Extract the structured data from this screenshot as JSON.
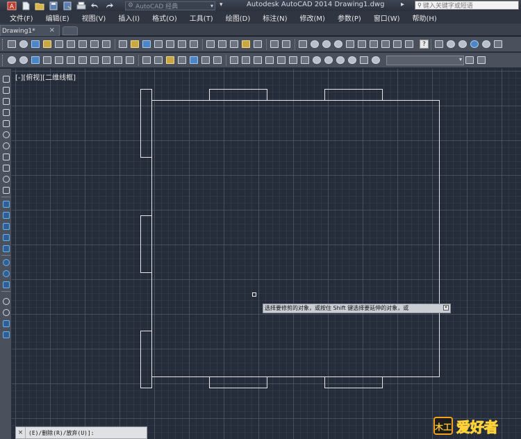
{
  "app": {
    "title": "Autodesk AutoCAD 2014    Drawing1.dwg",
    "workspace": "AutoCAD 经典",
    "help_search_placeholder": "键入关键字或短语"
  },
  "menu": [
    "文件(F)",
    "编辑(E)",
    "视图(V)",
    "插入(I)",
    "格式(O)",
    "工具(T)",
    "绘图(D)",
    "标注(N)",
    "修改(M)",
    "参数(P)",
    "窗口(W)",
    "帮助(H)"
  ],
  "tabs": {
    "active": "Drawing1*",
    "close_glyph": "×"
  },
  "toolbar": {
    "help_glyph": "?"
  },
  "viewport": {
    "label": "[-][俯视][二维线框]"
  },
  "tooltip": {
    "text": "选择要修剪的对象，或按住 Shift 键选择要延伸的对象，或",
    "expand_glyph": "▾"
  },
  "command": {
    "close_glyph": "×",
    "text": "(E)/删除(R)/放弃(U)]:"
  },
  "watermark": {
    "text": "爱好者",
    "logo": "木工"
  },
  "colors": {
    "canvas_bg": "#262d3a",
    "grid_major": "#586273",
    "line": "#e8e8e8"
  }
}
